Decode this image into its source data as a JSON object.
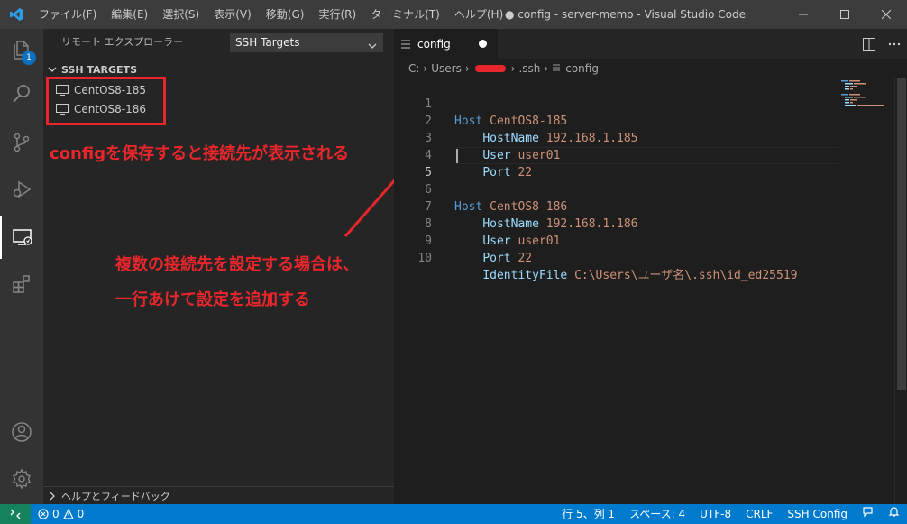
{
  "titlebar": {
    "menu": [
      "ファイル(F)",
      "編集(E)",
      "選択(S)",
      "表示(V)",
      "移動(G)",
      "実行(R)",
      "ターミナル(T)",
      "ヘルプ(H)"
    ],
    "window_title": "● config - server-memo - Visual Studio Code"
  },
  "activitybar": {
    "explorer_badge": "1",
    "icons": [
      "files-icon",
      "search-icon",
      "source-control-icon",
      "run-debug-icon",
      "remote-explorer-icon",
      "extensions-icon",
      "account-icon",
      "settings-gear-icon"
    ]
  },
  "sidebar": {
    "title": "リモート エクスプローラー",
    "dropdown_value": "SSH Targets",
    "section_title": "SSH TARGETS",
    "targets": [
      "CentOS8-185",
      "CentOS8-186"
    ],
    "help_section": "ヘルプとフィードバック"
  },
  "annotations": {
    "note1": "configを保存すると接続先が表示される",
    "note2": "複数の接続先を設定する場合は、",
    "note3": "一行あけて設定を追加する",
    "color": "#e8262b"
  },
  "editor": {
    "tab_label": "config",
    "breadcrumb": [
      "C:",
      "Users",
      ".ssh",
      "config"
    ],
    "line_numbers": [
      "1",
      "2",
      "3",
      "4",
      "5",
      "6",
      "7",
      "8",
      "9",
      "10"
    ],
    "lines": [
      {
        "key": "Host",
        "value": "CentOS8-185",
        "indent": false
      },
      {
        "key": "HostName",
        "value": "192.168.1.185",
        "indent": true
      },
      {
        "key": "User",
        "value": "user01",
        "indent": true
      },
      {
        "key": "Port",
        "value": "22",
        "indent": true
      },
      {
        "key": "",
        "value": "",
        "indent": false
      },
      {
        "key": "Host",
        "value": "CentOS8-186",
        "indent": false
      },
      {
        "key": "HostName",
        "value": "192.168.1.186",
        "indent": true
      },
      {
        "key": "User",
        "value": "user01",
        "indent": true
      },
      {
        "key": "Port",
        "value": "22",
        "indent": true
      },
      {
        "key": "IdentityFile",
        "value": "C:\\Users\\ユーザ名\\.ssh\\id_ed25519",
        "indent": true
      }
    ]
  },
  "statusbar": {
    "errors": "0",
    "warnings": "0",
    "position": "行 5、列 1",
    "spaces": "スペース: 4",
    "encoding": "UTF-8",
    "eol": "CRLF",
    "language": "SSH Config"
  }
}
